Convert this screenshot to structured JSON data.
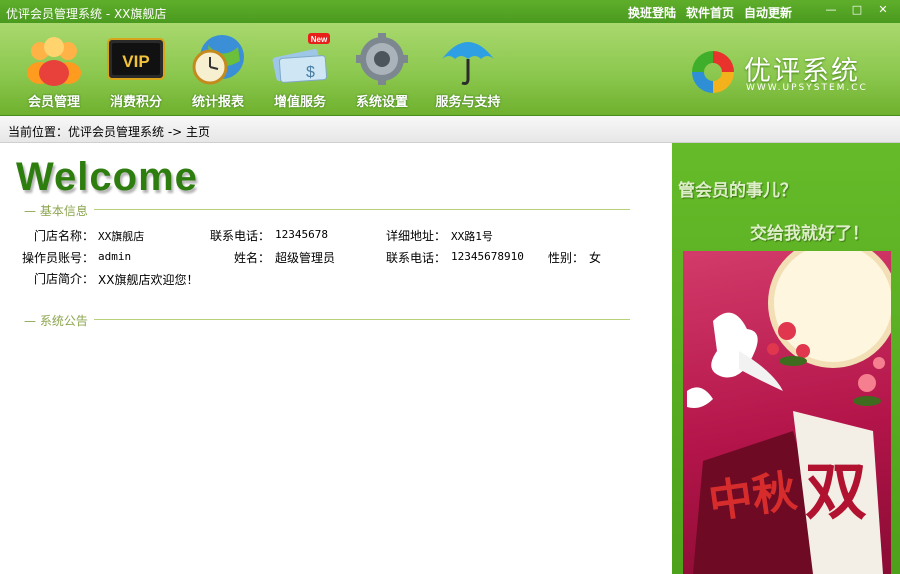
{
  "window": {
    "title": "优评会员管理系统 - XX旗舰店",
    "links": [
      "换班登陆",
      "软件首页",
      "自动更新"
    ],
    "controls": {
      "minimize": "—",
      "maximize": "□",
      "close": "✕"
    }
  },
  "toolbar": {
    "items": [
      {
        "label": "会员管理",
        "icon": "members-icon"
      },
      {
        "label": "消费积分",
        "icon": "vip-icon",
        "badge_text": "VIP"
      },
      {
        "label": "统计报表",
        "icon": "clock-globe-icon"
      },
      {
        "label": "增值服务",
        "icon": "card-money-icon",
        "badge": "New"
      },
      {
        "label": "系统设置",
        "icon": "gear-icon"
      },
      {
        "label": "服务与支持",
        "icon": "umbrella-icon"
      }
    ]
  },
  "logo": {
    "name": "优评系统",
    "url": "WWW.UPSYSTEM.CC"
  },
  "breadcrumb": {
    "label": "当前位置：",
    "path": "优评会员管理系统 -> 主页"
  },
  "main": {
    "welcome": "Welcome",
    "basic_section": "基本信息",
    "notice_section": "系统公告",
    "fields": {
      "store_name_label": "门店名称：",
      "store_name": "XX旗舰店",
      "phone_label": "联系电话：",
      "phone": "12345678",
      "address_label": "详细地址：",
      "address": "XX路1号",
      "operator_label": "操作员账号：",
      "operator": "admin",
      "name_label": "姓名：",
      "name": "超级管理员",
      "contact_phone_label": "联系电话：",
      "contact_phone": "12345678910",
      "gender_label": "性别：",
      "gender": "女",
      "intro_label": "门店简介：",
      "intro": "XX旗舰店欢迎您！"
    }
  },
  "side": {
    "slogan1": "管会员的事儿？",
    "slogan2": "交给我就好了！",
    "banner_text1": "中秋",
    "banner_text2": "双"
  },
  "colors": {
    "brand_green": "#6fb12e",
    "title_green": "#2e7d0f"
  }
}
